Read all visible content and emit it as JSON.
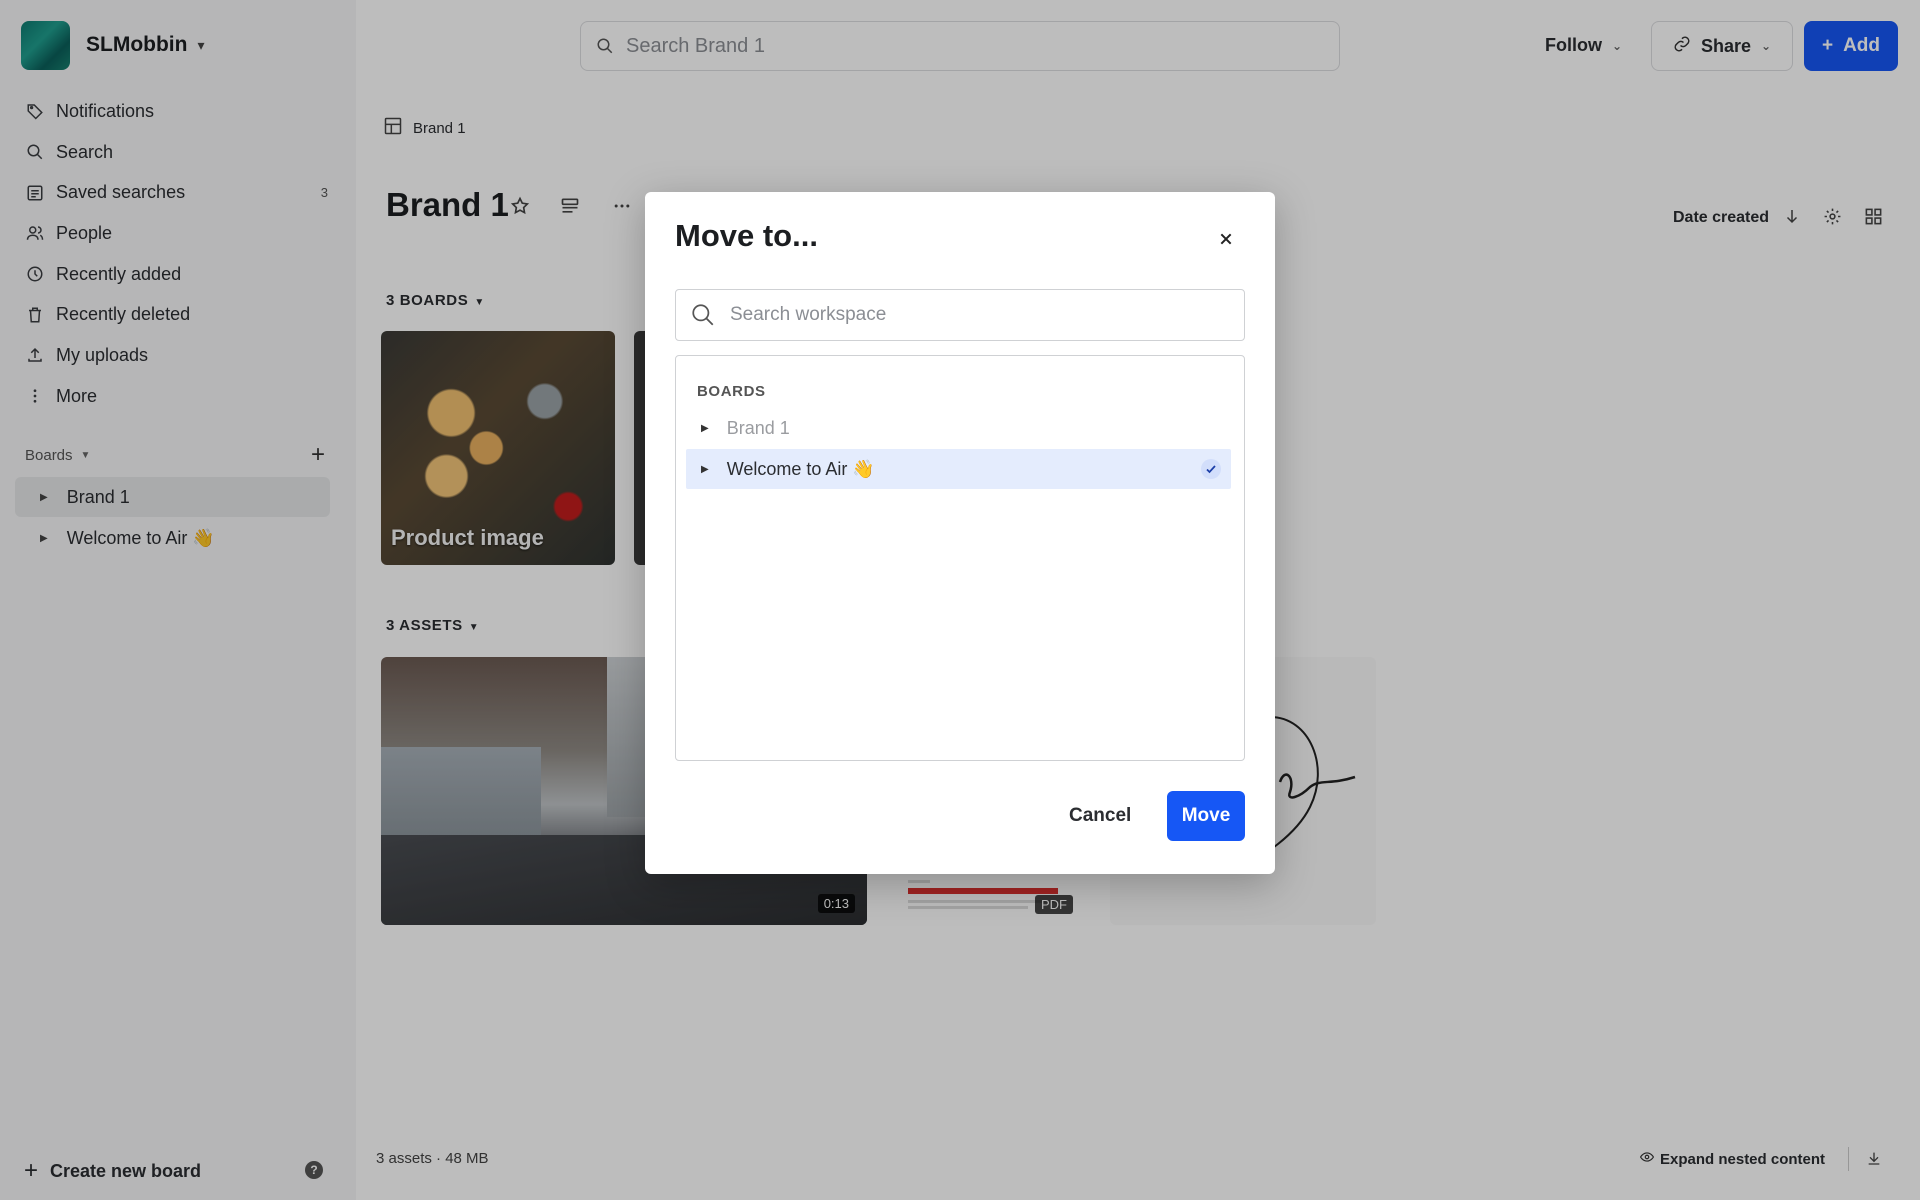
{
  "workspace": {
    "name": "SLMobbin"
  },
  "sidebar": {
    "nav": [
      {
        "label": "Notifications",
        "icon": "tag-icon"
      },
      {
        "label": "Search",
        "icon": "search-icon"
      },
      {
        "label": "Saved searches",
        "icon": "saved-searches-icon",
        "count": "3"
      },
      {
        "label": "People",
        "icon": "people-icon"
      },
      {
        "label": "Recently added",
        "icon": "clock-icon"
      },
      {
        "label": "Recently deleted",
        "icon": "trash-icon"
      },
      {
        "label": "My uploads",
        "icon": "upload-icon"
      },
      {
        "label": "More",
        "icon": "more-vertical-icon"
      }
    ],
    "boards_header": "Boards",
    "boards": [
      {
        "label": "Brand 1",
        "active": true
      },
      {
        "label": "Welcome to Air 👋",
        "active": false
      }
    ],
    "create_board": "Create new board"
  },
  "topbar": {
    "search_placeholder": "Search Brand 1",
    "follow": "Follow",
    "share": "Share",
    "add": "Add"
  },
  "main": {
    "breadcrumb": "Brand 1",
    "title": "Brand 1",
    "sort_label": "Date created",
    "boards_section": "3 BOARDS",
    "board_cards": [
      {
        "label": "Product image"
      }
    ],
    "assets_section": "3 ASSETS",
    "assets": [
      {
        "type": "video",
        "badge": "0:13"
      },
      {
        "type": "pdf",
        "badge": "PDF"
      },
      {
        "type": "image",
        "badge": ""
      }
    ],
    "footer_stats": "3 assets · 48 MB",
    "expand_nested": "Expand nested content"
  },
  "modal": {
    "title": "Move to...",
    "search_placeholder": "Search workspace",
    "section_header": "BOARDS",
    "items": [
      {
        "label": "Brand 1",
        "disabled": true,
        "selected": false
      },
      {
        "label": "Welcome to Air 👋",
        "disabled": false,
        "selected": true
      }
    ],
    "cancel": "Cancel",
    "move": "Move"
  },
  "colors": {
    "accent": "#1657f5",
    "selected_row": "#e4ecfd",
    "sidebar_bg": "#f6f6f7"
  }
}
